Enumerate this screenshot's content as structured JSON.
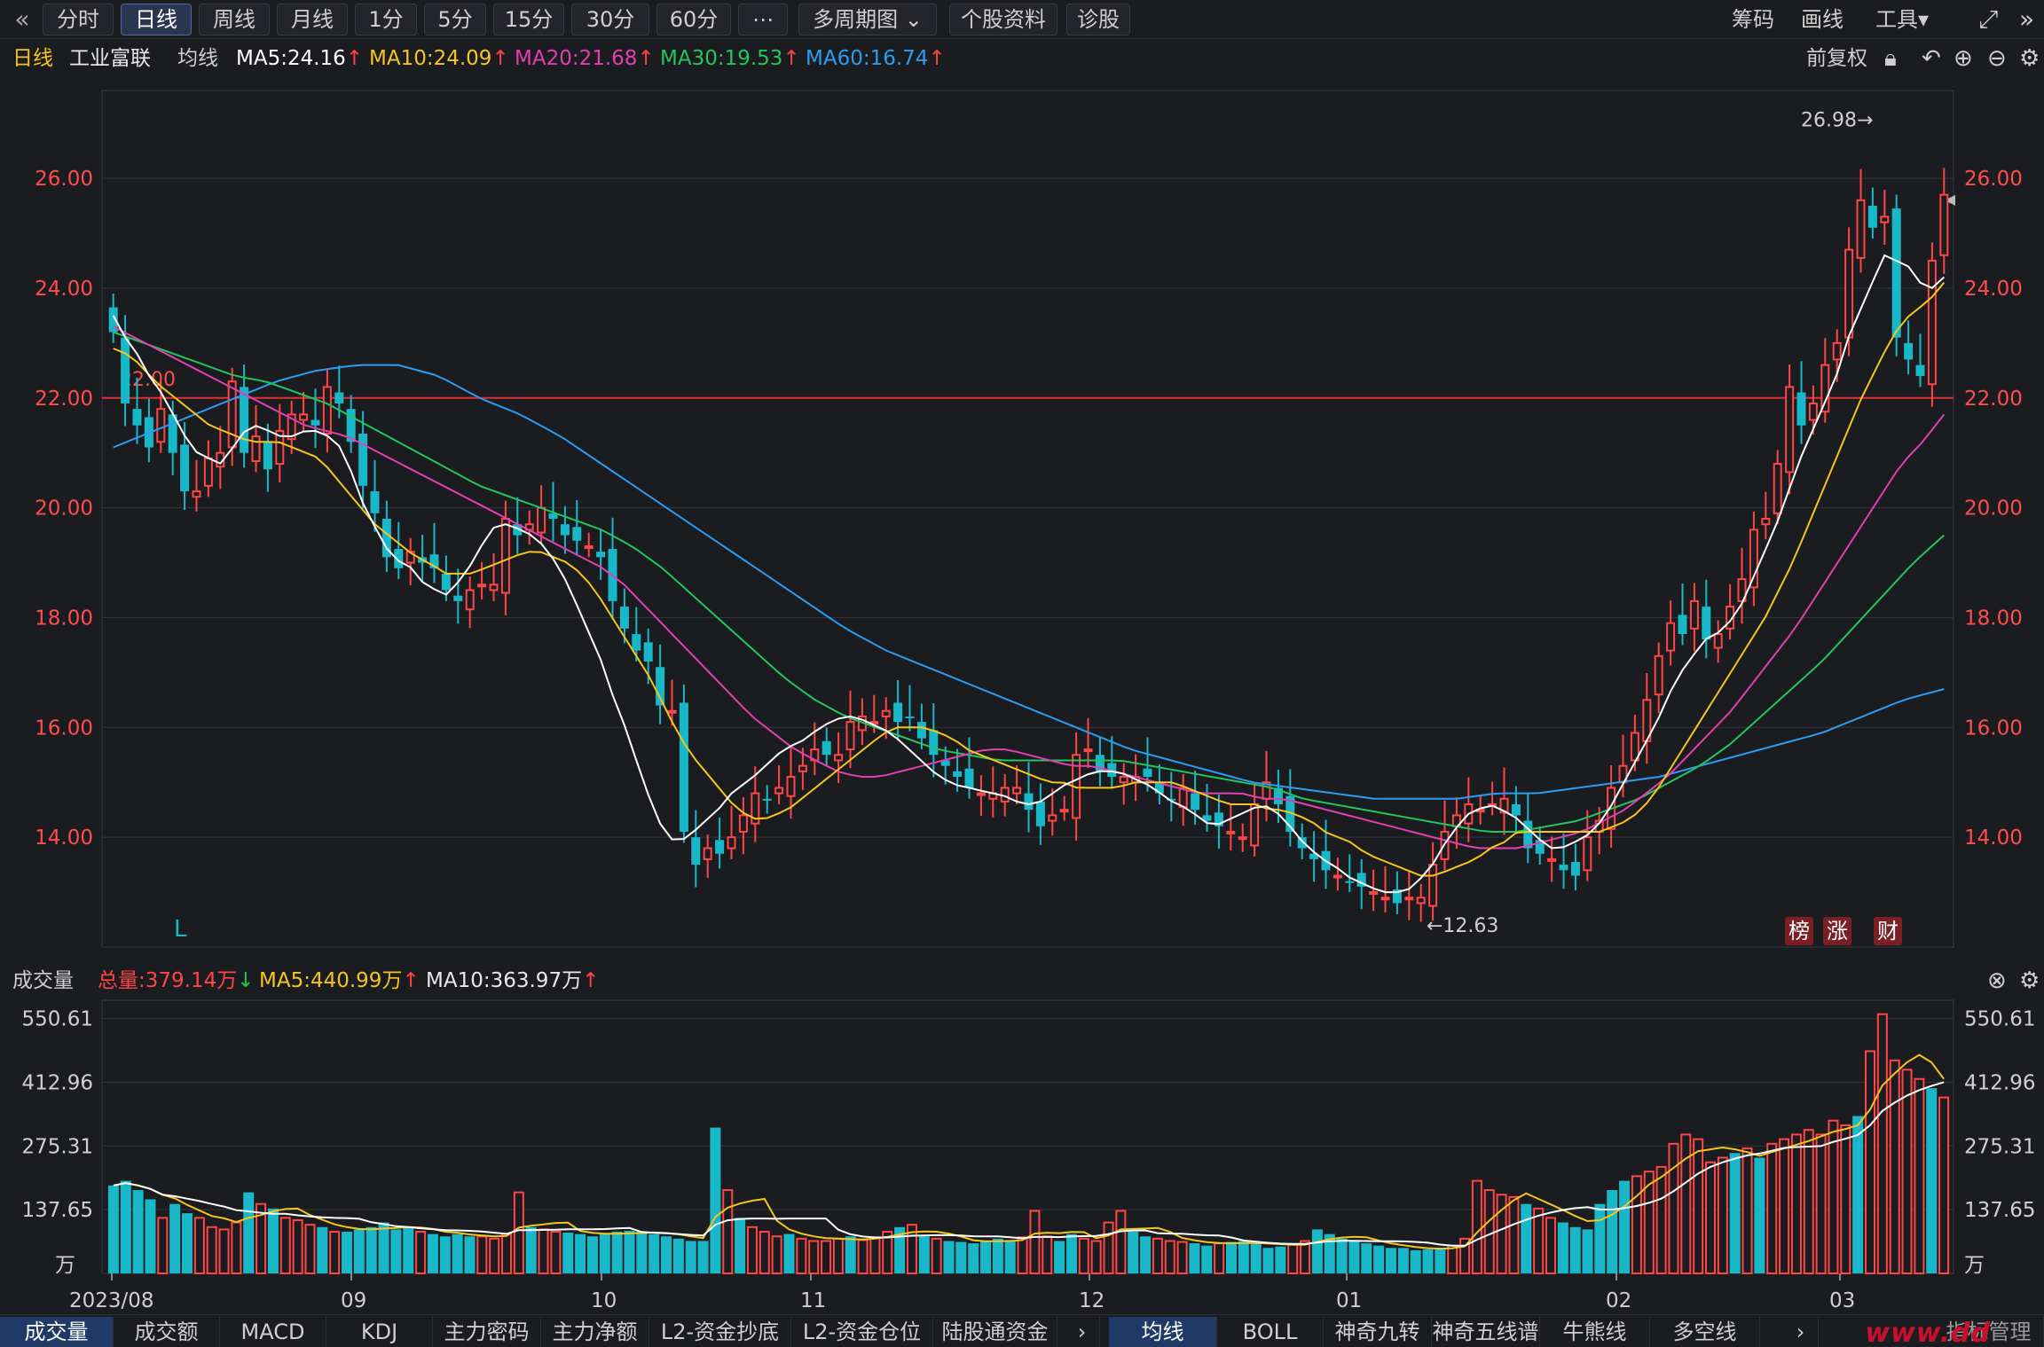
{
  "toolbar": {
    "back_icon": "«",
    "buttons": [
      "分时",
      "日线",
      "周线",
      "月线",
      "1分",
      "5分",
      "15分",
      "30分",
      "60分",
      "⋯",
      "多周期图 ⌄",
      "个股资料",
      "诊股"
    ],
    "active_index": 1,
    "right": [
      "筹码",
      "画线",
      "工具▾"
    ],
    "fullscreen_icon": "⤢",
    "next_icon": "»"
  },
  "ma_bar": {
    "period": "日线",
    "stock_name": "工业富联",
    "label": "均线",
    "ma5": "MA5:24.16",
    "ma10": "MA10:24.09",
    "ma20": "MA20:21.68",
    "ma30": "MA30:19.53",
    "ma60": "MA60:16.74",
    "adjust": "前复权",
    "colors": {
      "ma5": "#ffffff",
      "ma10": "#f4c51f",
      "ma20": "#e040b0",
      "ma30": "#22c55e",
      "ma60": "#2b9cf2"
    }
  },
  "price_axis": {
    "ticks": [
      "26.00",
      "24.00",
      "22.00",
      "20.00",
      "18.00",
      "16.00",
      "14.00"
    ],
    "high_label": "26.98→",
    "low_label": "←12.63",
    "ref_label": "22.00",
    "marker_l": "L"
  },
  "badges": [
    "榜",
    "涨",
    "财"
  ],
  "volume_bar": {
    "label": "成交量",
    "total": "总量:379.14万",
    "ma5": "MA5:440.99万",
    "ma10": "MA10:363.97万"
  },
  "volume_axis": {
    "ticks": [
      "550.61",
      "412.96",
      "275.31",
      "137.65"
    ],
    "unit": "万"
  },
  "date_axis": [
    "2023/08",
    "09",
    "10",
    "11",
    "12",
    "01",
    "02",
    "03"
  ],
  "tabs_left": [
    "成交量",
    "成交额",
    "MACD",
    "KDJ",
    "主力密码",
    "主力净额",
    "L2-资金抄底",
    "L2-资金仓位",
    "陆股通资金"
  ],
  "tabs_right": [
    "均线",
    "BOLL",
    "神奇九转",
    "神奇五线谱",
    "牛熊线",
    "多空线"
  ],
  "tabs_extra": "指标管理",
  "watermark": "www.dd",
  "chart_data": {
    "type": "candlestick",
    "close": [
      23.2,
      21.9,
      21.5,
      21.1,
      21.8,
      21.0,
      20.3,
      20.3,
      20.9,
      21.0,
      22.3,
      21.0,
      21.3,
      20.7,
      21.4,
      21.7,
      21.7,
      21.5,
      22.2,
      21.9,
      21.2,
      20.4,
      19.9,
      19.1,
      18.9,
      19.2,
      19.0,
      18.9,
      18.5,
      18.3,
      18.5,
      18.6,
      18.6,
      19.8,
      19.5,
      19.7,
      20.0,
      19.8,
      19.5,
      19.4,
      19.3,
      19.1,
      18.3,
      17.8,
      17.4,
      17.2,
      16.4,
      16.3,
      14.1,
      13.5,
      13.8,
      13.7,
      14.0,
      14.4,
      14.8,
      14.7,
      14.9,
      15.1,
      15.3,
      15.6,
      15.5,
      15.5,
      16.1,
      16.2,
      16.1,
      16.3,
      16.1,
      16.2,
      15.8,
      15.5,
      15.3,
      15.1,
      14.9,
      14.8,
      14.8,
      14.9,
      14.9,
      14.5,
      14.2,
      14.4,
      14.5,
      15.5,
      15.6,
      15.2,
      15.1,
      15.1,
      15.1,
      15.1,
      14.8,
      14.7,
      14.9,
      14.5,
      14.3,
      14.2,
      14.1,
      14.0,
      14.6,
      15.0,
      14.6,
      14.1,
      13.8,
      13.6,
      13.4,
      13.3,
      13.2,
      13.1,
      13.0,
      12.9,
      12.8,
      12.9,
      12.9,
      13.5,
      14.1,
      14.4,
      14.6,
      14.5,
      14.6,
      14.7,
      14.4,
      13.8,
      13.7,
      13.6,
      13.4,
      13.3,
      14.0,
      14.3,
      14.9,
      15.3,
      15.9,
      16.5,
      17.3,
      17.9,
      17.7,
      18.3,
      17.6,
      17.7,
      18.2,
      18.7,
      19.6,
      19.8,
      20.8,
      22.2,
      21.5,
      21.9,
      22.6,
      23.0,
      24.7,
      25.6,
      25.1,
      25.3,
      23.1,
      22.7,
      22.4,
      24.5,
      25.7
    ],
    "ma5": [
      23.5,
      23.1,
      22.8,
      22.4,
      22.1,
      21.7,
      21.3,
      21.0,
      20.9,
      20.8,
      21.1,
      21.4,
      21.5,
      21.4,
      21.3,
      21.3,
      21.4,
      21.4,
      21.3,
      21.1,
      20.6,
      20.0,
      19.6,
      19.2,
      19.0,
      18.9,
      18.6,
      18.5,
      18.4,
      18.7,
      19.0,
      19.4,
      19.7,
      19.7,
      19.6,
      19.5,
      19.3,
      19.0,
      18.6,
      18.1,
      17.6,
      17.1,
      16.4,
      15.9,
      15.2,
      14.6,
      14.1,
      13.9,
      14.0,
      14.2,
      14.4,
      14.6,
      14.9,
      15.0,
      15.2,
      15.4,
      15.6,
      15.7,
      15.8,
      16.0,
      16.1,
      16.2,
      16.2,
      16.1,
      16.0,
      15.9,
      15.7,
      15.5,
      15.3,
      15.1,
      15.0,
      14.9,
      14.9,
      14.8,
      14.8,
      14.7,
      14.6,
      14.6,
      14.7,
      14.9,
      15.0,
      15.1,
      15.2,
      15.2,
      15.2,
      15.1,
      15.0,
      14.9,
      14.7,
      14.6,
      14.5,
      14.3,
      14.2,
      14.3,
      14.4,
      14.5,
      14.6,
      14.5,
      14.3,
      14.0,
      13.8,
      13.6,
      13.5,
      13.3,
      13.2,
      13.1,
      13.0,
      13.0,
      13.0,
      13.2,
      13.4,
      13.8,
      14.1,
      14.4,
      14.5,
      14.6,
      14.5,
      14.4,
      14.2,
      14.0,
      13.8,
      13.8,
      13.9,
      14.0,
      14.2,
      14.5,
      14.9,
      15.3,
      15.7,
      16.1,
      16.6,
      17.0,
      17.3,
      17.6,
      17.7,
      17.9,
      18.2,
      18.7,
      19.2,
      19.7,
      20.3,
      20.9,
      21.4,
      21.9,
      22.4,
      23.1,
      23.6,
      24.1,
      24.6,
      24.5,
      24.4,
      24.1,
      24.0,
      24.2
    ],
    "ma10": [
      22.9,
      22.8,
      22.6,
      22.3,
      22.1,
      21.9,
      21.7,
      21.5,
      21.4,
      21.3,
      21.2,
      21.2,
      21.2,
      21.1,
      21.0,
      20.9,
      20.6,
      20.3,
      20.0,
      19.7,
      19.5,
      19.3,
      19.1,
      19.0,
      18.8,
      18.8,
      18.8,
      18.9,
      19.0,
      19.1,
      19.2,
      19.2,
      19.1,
      19.0,
      18.8,
      18.5,
      18.1,
      17.7,
      17.3,
      16.9,
      16.4,
      15.9,
      15.5,
      15.2,
      14.9,
      14.6,
      14.4,
      14.3,
      14.4,
      14.5,
      14.7,
      14.9,
      15.1,
      15.3,
      15.5,
      15.7,
      15.9,
      16.0,
      16.0,
      16.0,
      15.9,
      15.8,
      15.6,
      15.5,
      15.4,
      15.3,
      15.2,
      15.1,
      15.0,
      15.0,
      14.9,
      14.9,
      14.9,
      14.9,
      15.0,
      15.0,
      15.0,
      15.0,
      14.9,
      14.8,
      14.7,
      14.6,
      14.6,
      14.6,
      14.5,
      14.5,
      14.4,
      14.3,
      14.1,
      14.0,
      13.9,
      13.7,
      13.6,
      13.5,
      13.4,
      13.3,
      13.3,
      13.4,
      13.5,
      13.6,
      13.8,
      13.9,
      14.1,
      14.1,
      14.1,
      14.1,
      14.1,
      14.1,
      14.1,
      14.2,
      14.3,
      14.5,
      14.8,
      15.2,
      15.6,
      16.0,
      16.4,
      16.8,
      17.2,
      17.6,
      18.0,
      18.5,
      19.0,
      19.6,
      20.2,
      20.8,
      21.4,
      22.0,
      22.5,
      23.0,
      23.4,
      23.6,
      23.8,
      24.1
    ],
    "ma20": [
      23.3,
      23.1,
      22.9,
      22.7,
      22.5,
      22.3,
      22.1,
      21.9,
      21.7,
      21.5,
      21.4,
      21.3,
      21.1,
      20.9,
      20.7,
      20.5,
      20.3,
      20.1,
      19.9,
      19.7,
      19.5,
      19.3,
      19.1,
      18.9,
      18.6,
      18.2,
      17.8,
      17.4,
      17.0,
      16.6,
      16.2,
      15.9,
      15.6,
      15.4,
      15.2,
      15.1,
      15.1,
      15.2,
      15.3,
      15.4,
      15.5,
      15.6,
      15.6,
      15.5,
      15.4,
      15.3,
      15.3,
      15.2,
      15.1,
      15.0,
      14.9,
      14.8,
      14.8,
      14.8,
      14.7,
      14.7,
      14.6,
      14.5,
      14.4,
      14.3,
      14.2,
      14.1,
      14.0,
      13.9,
      13.8,
      13.8,
      13.8,
      13.9,
      14.0,
      14.1,
      14.3,
      14.5,
      14.8,
      15.1,
      15.5,
      15.9,
      16.3,
      16.8,
      17.3,
      17.8,
      18.4,
      19.0,
      19.6,
      20.2,
      20.8,
      21.2,
      21.7
    ],
    "ma30": [
      23.2,
      23.0,
      22.8,
      22.6,
      22.4,
      22.3,
      22.1,
      21.9,
      21.6,
      21.3,
      21.0,
      20.7,
      20.4,
      20.2,
      20.0,
      19.8,
      19.6,
      19.3,
      18.9,
      18.4,
      17.9,
      17.4,
      16.9,
      16.5,
      16.2,
      16.0,
      15.8,
      15.6,
      15.5,
      15.4,
      15.4,
      15.4,
      15.4,
      15.4,
      15.3,
      15.2,
      15.1,
      15.0,
      14.9,
      14.7,
      14.6,
      14.5,
      14.4,
      14.3,
      14.2,
      14.1,
      14.1,
      14.2,
      14.3,
      14.5,
      14.7,
      15.0,
      15.3,
      15.7,
      16.2,
      16.7,
      17.2,
      17.8,
      18.4,
      19.0,
      19.5
    ],
    "ma60": [
      21.1,
      21.4,
      21.7,
      22.0,
      22.3,
      22.5,
      22.6,
      22.6,
      22.4,
      22.0,
      21.7,
      21.3,
      20.8,
      20.3,
      19.8,
      19.3,
      18.8,
      18.3,
      17.8,
      17.4,
      17.1,
      16.8,
      16.5,
      16.2,
      15.9,
      15.6,
      15.4,
      15.2,
      15.0,
      14.9,
      14.8,
      14.7,
      14.7,
      14.7,
      14.8,
      14.8,
      14.9,
      15.0,
      15.1,
      15.3,
      15.5,
      15.7,
      15.9,
      16.2,
      16.5,
      16.7
    ],
    "volume": [
      190,
      200,
      180,
      160,
      120,
      150,
      130,
      120,
      100,
      95,
      110,
      175,
      150,
      140,
      120,
      115,
      105,
      100,
      90,
      90,
      95,
      100,
      110,
      95,
      100,
      90,
      85,
      80,
      85,
      80,
      80,
      75,
      85,
      175,
      100,
      95,
      90,
      88,
      85,
      80,
      85,
      90,
      92,
      90,
      85,
      80,
      75,
      70,
      70,
      315,
      180,
      120,
      100,
      90,
      80,
      85,
      75,
      70,
      70,
      75,
      80,
      72,
      78,
      90,
      100,
      105,
      80,
      75,
      70,
      68,
      65,
      70,
      75,
      72,
      78,
      135,
      80,
      70,
      85,
      75,
      70,
      110,
      135,
      90,
      80,
      75,
      70,
      68,
      65,
      60,
      65,
      68,
      70,
      65,
      55,
      58,
      62,
      70,
      95,
      85,
      75,
      70,
      65,
      60,
      55,
      55,
      50,
      52,
      55,
      60,
      75,
      200,
      180,
      170,
      165,
      150,
      140,
      120,
      110,
      100,
      95,
      150,
      180,
      200,
      210,
      220,
      230,
      280,
      300,
      290,
      240,
      250,
      260,
      270,
      250,
      280,
      290,
      300,
      310,
      300,
      330,
      320,
      340,
      480,
      560,
      460,
      440,
      420,
      400,
      380
    ]
  }
}
